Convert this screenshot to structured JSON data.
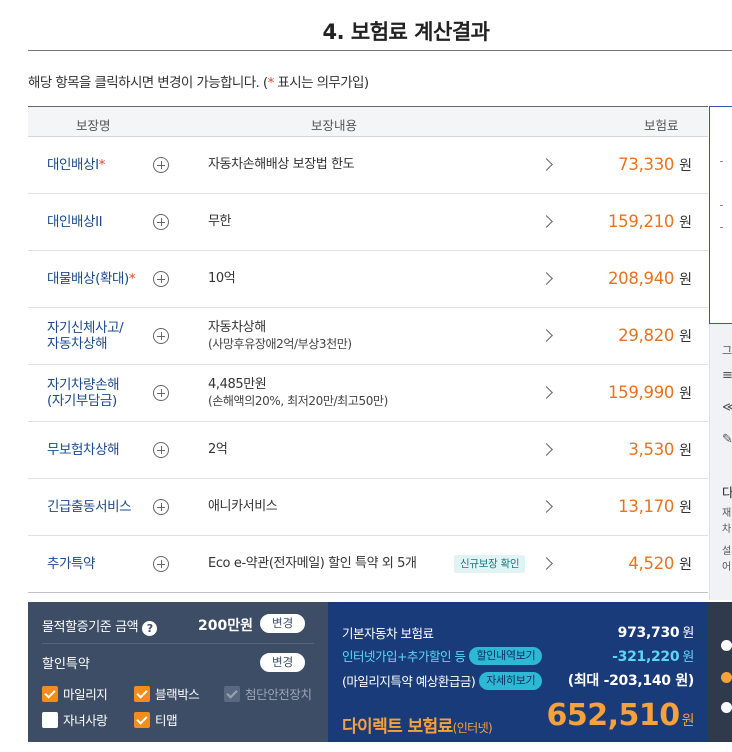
{
  "title": "4. 보험료 계산결과",
  "notice": {
    "before": "해당 항목을 클릭하시면 변경이 가능합니다. (",
    "star": "*",
    "after": " 표시는 의무가입)"
  },
  "table": {
    "headers": {
      "name": "보장명",
      "detail": "보장내용",
      "premium": "보험료"
    },
    "unit": "원",
    "rows": [
      {
        "name": "대인배상I",
        "required": "*",
        "detail": "자동차손해배상 보장법 한도",
        "sub": "",
        "badge": "",
        "premium": "73,330"
      },
      {
        "name": "대인배상II",
        "required": "",
        "detail": "무한",
        "sub": "",
        "badge": "",
        "premium": "159,210"
      },
      {
        "name": "대물배상(확대)",
        "required": "*",
        "detail": "10억",
        "sub": "",
        "badge": "",
        "premium": "208,940"
      },
      {
        "name": "자기신체사고/\n자동차상해",
        "required": "",
        "detail": "자동차상해",
        "sub": "(사망후유장애2억/부상3천만)",
        "badge": "",
        "premium": "29,820"
      },
      {
        "name": "자기차량손해\n(자기부담금)",
        "required": "",
        "detail": "4,485만원",
        "sub": "(손해액의20%, 최저20만/최고50만)",
        "badge": "",
        "premium": "159,990"
      },
      {
        "name": "무보험차상해",
        "required": "",
        "detail": "2억",
        "sub": "",
        "badge": "",
        "premium": "3,530"
      },
      {
        "name": "긴급출동서비스",
        "required": "",
        "detail": "애니카서비스",
        "sub": "",
        "badge": "",
        "premium": "13,170"
      },
      {
        "name": "추가특약",
        "required": "",
        "detail": "Eco e-약관(전자메일) 할인 특약 외 5개",
        "sub": "",
        "badge": "신규보장 확인",
        "premium": "4,520"
      }
    ]
  },
  "side": {
    "labels": [
      "그",
      "다",
      "재",
      "차",
      "설",
      "어"
    ]
  },
  "bottom": {
    "property_label": "물적할증기준 금액",
    "help": "?",
    "property_amount": "200만원",
    "change_label": "변경",
    "discount_label": "할인특약",
    "checkboxes": [
      {
        "label": "마일리지",
        "state": "on"
      },
      {
        "label": "블랙박스",
        "state": "on"
      },
      {
        "label": "첨단안전장치",
        "state": "dis"
      },
      {
        "label": "자녀사랑",
        "state": "off"
      },
      {
        "label": "티맵",
        "state": "on"
      }
    ],
    "base_label": "기본자동차 보험료",
    "base_value": "973,730",
    "online_label": "인터넷가입+추가할인 등",
    "online_pill": "할인내역보기",
    "online_value": "-321,220",
    "mileage_label": "(마일리지특약 예상환급금)",
    "mileage_pill": "자세히보기",
    "mileage_value": "(최대 -203,140 원)",
    "direct_label": "다이렉트 보험료",
    "direct_sub": "(인터넷)",
    "total": "652,510",
    "unit": "원"
  },
  "colors": {
    "accent_orange": "#e8731f",
    "navy": "#1a3b7a",
    "slate": "#3d4d66",
    "link_blue": "#1d4a8c"
  }
}
